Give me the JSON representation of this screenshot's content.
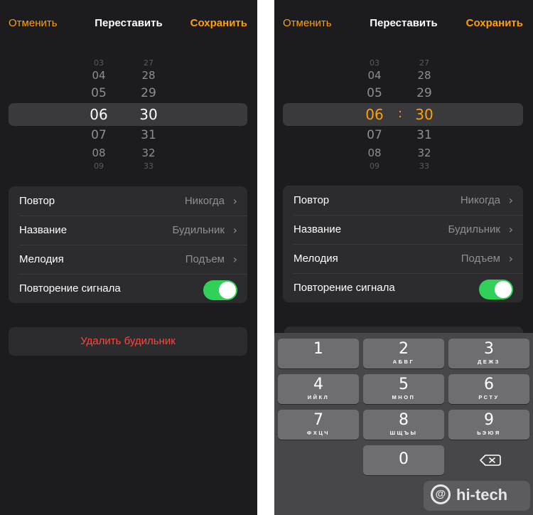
{
  "left_screen": {
    "header": {
      "cancel_label": "Отменить",
      "title": "Переставить",
      "save_label": "Сохранить"
    },
    "picker": {
      "hours": [
        "03",
        "04",
        "05",
        "06",
        "07",
        "08",
        "09"
      ],
      "minutes": [
        "27",
        "28",
        "29",
        "30",
        "31",
        "32",
        "33"
      ],
      "selected_hour": "06",
      "selected_minute": "30"
    },
    "settings": [
      {
        "label": "Повтор",
        "value": "Никогда"
      },
      {
        "label": "Название",
        "value": "Будильник"
      },
      {
        "label": "Мелодия",
        "value": "Подъем"
      },
      {
        "label": "Повторение сигнала",
        "toggle_on": true
      }
    ],
    "delete_label": "Удалить будильник"
  },
  "right_screen": {
    "header": {
      "cancel_label": "Отменить",
      "title": "Переставить",
      "save_label": "Сохранить"
    },
    "picker": {
      "hours": [
        "03",
        "04",
        "05",
        "06",
        "07",
        "08",
        "09"
      ],
      "minutes": [
        "27",
        "28",
        "29",
        "30",
        "31",
        "32",
        "33"
      ],
      "selected_hour": "06",
      "selected_minute": "30",
      "separator": ":",
      "accent_color": "#ff9f0a"
    },
    "settings": [
      {
        "label": "Повтор",
        "value": "Никогда"
      },
      {
        "label": "Название",
        "value": "Будильник"
      },
      {
        "label": "Мелодия",
        "value": "Подъем"
      },
      {
        "label": "Повторение сигнала",
        "toggle_on": true
      }
    ],
    "keypad": [
      {
        "digit": "1",
        "letters": ""
      },
      {
        "digit": "2",
        "letters": "АБВГ"
      },
      {
        "digit": "3",
        "letters": "ДЕЖЗ"
      },
      {
        "digit": "4",
        "letters": "ИЙКЛ"
      },
      {
        "digit": "5",
        "letters": "МНОП"
      },
      {
        "digit": "6",
        "letters": "РСТУ"
      },
      {
        "digit": "7",
        "letters": "ФХЦЧ"
      },
      {
        "digit": "8",
        "letters": "ШЩЪЫ"
      },
      {
        "digit": "9",
        "letters": "ЬЭЮЯ"
      },
      {
        "digit": "0",
        "letters": ""
      }
    ],
    "backspace_icon": "delete-left-icon"
  },
  "watermark": {
    "symbol": "@",
    "text": "hi-tech"
  },
  "colors": {
    "background": "#1c1c1e",
    "card": "#2c2c2e",
    "accent": "#ff9f0a",
    "toggle_on": "#30d158",
    "destructive": "#ff453a",
    "secondary_text": "#8e8e93"
  }
}
